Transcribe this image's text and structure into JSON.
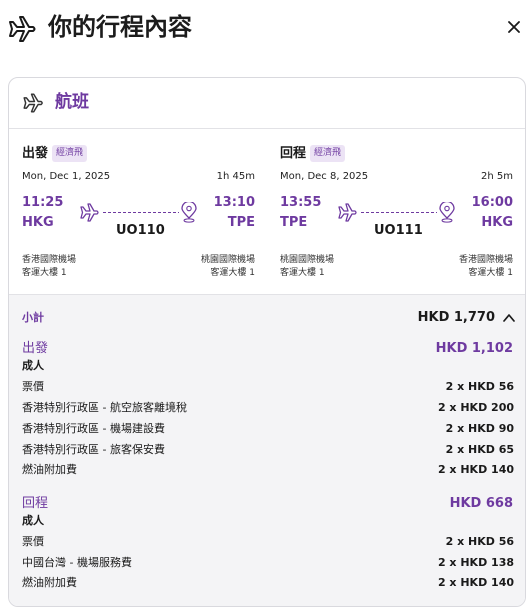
{
  "header": {
    "title": "你的行程內容",
    "icon": "airplane-icon",
    "close_icon": "close-icon"
  },
  "card": {
    "title": "航班",
    "icon": "airplane-icon",
    "accent_color": "#6e3aa0",
    "outbound": {
      "direction": "出發",
      "cabin": "經濟飛",
      "date": "Mon, Dec 1, 2025",
      "duration": "1h 45m",
      "depart_time": "11:25",
      "depart_code": "HKG",
      "arrive_time": "13:10",
      "arrive_code": "TPE",
      "flight_no": "UO110",
      "depart_airport": "香港國際機場",
      "depart_terminal": "客運大樓 1",
      "arrive_airport": "桃園國際機場",
      "arrive_terminal": "客運大樓 1"
    },
    "return": {
      "direction": "回程",
      "cabin": "經濟飛",
      "date": "Mon, Dec 8, 2025",
      "duration": "2h 5m",
      "depart_time": "13:55",
      "depart_code": "TPE",
      "arrive_time": "16:00",
      "arrive_code": "HKG",
      "flight_no": "UO111",
      "depart_airport": "桃園國際機場",
      "depart_terminal": "客運大樓 1",
      "arrive_airport": "香港國際機場",
      "arrive_terminal": "客運大樓 1"
    }
  },
  "summary": {
    "subtotal_label": "小計",
    "subtotal_value": "HKD 1,770",
    "outbound": {
      "title": "出發",
      "total": "HKD 1,102",
      "passenger": "成人",
      "items": [
        {
          "name": "票價",
          "value": "2 x HKD 56"
        },
        {
          "name": "香港特別行政區 - 航空旅客離境稅",
          "value": "2 x HKD 200"
        },
        {
          "name": "香港特別行政區 - 機場建設費",
          "value": "2 x HKD 90"
        },
        {
          "name": "香港特別行政區 - 旅客保安費",
          "value": "2 x HKD 65"
        },
        {
          "name": "燃油附加費",
          "value": "2 x HKD 140"
        }
      ]
    },
    "return": {
      "title": "回程",
      "total": "HKD 668",
      "passenger": "成人",
      "items": [
        {
          "name": "票價",
          "value": "2 x HKD 56"
        },
        {
          "name": "中國台灣 - 機場服務費",
          "value": "2 x HKD 138"
        },
        {
          "name": "燃油附加費",
          "value": "2 x HKD 140"
        }
      ]
    }
  }
}
